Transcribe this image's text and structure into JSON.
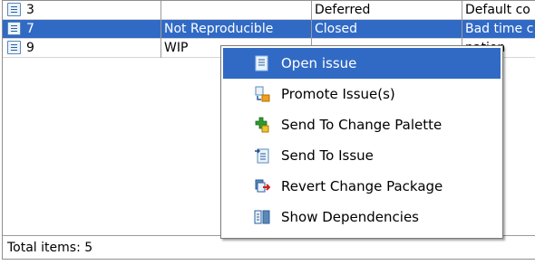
{
  "table": {
    "rows": [
      {
        "id": "3",
        "col2": "",
        "col3": "Deferred",
        "col4": "Default co",
        "selected": false
      },
      {
        "id": "7",
        "col2": "Not Reproducible",
        "col3": "Closed",
        "col4": "Bad time c",
        "selected": true
      },
      {
        "id": "9",
        "col2": "WIP",
        "col3": "",
        "col4": "nation",
        "selected": false
      }
    ]
  },
  "status_bar": {
    "text": "Total items: 5"
  },
  "context_menu": {
    "items": [
      {
        "label": "Open issue",
        "icon": "open-issue-icon",
        "highlighted": true
      },
      {
        "label": "Promote Issue(s)",
        "icon": "promote-icon"
      },
      {
        "label": "Send To Change Palette",
        "icon": "change-palette-icon"
      },
      {
        "label": "Send To Issue",
        "icon": "send-to-issue-icon"
      },
      {
        "label": "Revert Change Package",
        "icon": "revert-icon"
      },
      {
        "label": "Show Dependencies",
        "icon": "dependencies-icon"
      }
    ]
  },
  "colors": {
    "selection": "#316ac5",
    "menu_border": "#7a7a7a"
  }
}
